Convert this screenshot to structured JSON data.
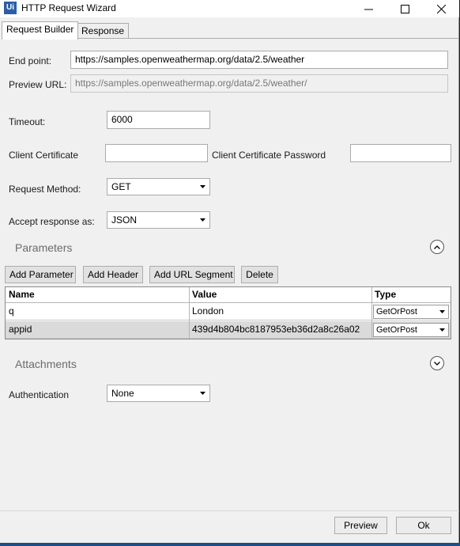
{
  "window": {
    "app_icon": "Ui",
    "title": "HTTP Request Wizard"
  },
  "tabs": [
    {
      "label": "Request Builder",
      "active": true
    },
    {
      "label": "Response",
      "active": false
    }
  ],
  "form": {
    "endpoint_label": "End point:",
    "endpoint_value": "https://samples.openweathermap.org/data/2.5/weather",
    "preview_label": "Preview URL:",
    "preview_value": "https://samples.openweathermap.org/data/2.5/weather/",
    "timeout_label": "Timeout:",
    "timeout_value": "6000",
    "cert_label": "Client Certificate",
    "cert_value": "",
    "cert_password_label": "Client Certificate Password",
    "cert_password_value": "",
    "method_label": "Request Method:",
    "method_value": "GET",
    "accept_label": "Accept response as:",
    "accept_value": "JSON"
  },
  "parameters": {
    "title": "Parameters",
    "buttons": {
      "add_parameter": "Add Parameter",
      "add_header": "Add Header",
      "add_url_segment": "Add URL Segment",
      "delete": "Delete"
    },
    "columns": [
      "Name",
      "Value",
      "Type"
    ],
    "rows": [
      {
        "name": "q",
        "value": "London",
        "type": "GetOrPost",
        "selected": false
      },
      {
        "name": "appid",
        "value": "439d4b804bc8187953eb36d2a8c26a02",
        "type": "GetOrPost",
        "selected": true
      }
    ]
  },
  "attachments": {
    "title": "Attachments"
  },
  "authentication": {
    "label": "Authentication",
    "value": "None"
  },
  "footer": {
    "preview_button": "Preview",
    "ok_button": "Ok"
  },
  "colors": {
    "accent": "#2a5fa8",
    "taskbar": "#1c4f8a",
    "selected_row": "#dadada"
  }
}
